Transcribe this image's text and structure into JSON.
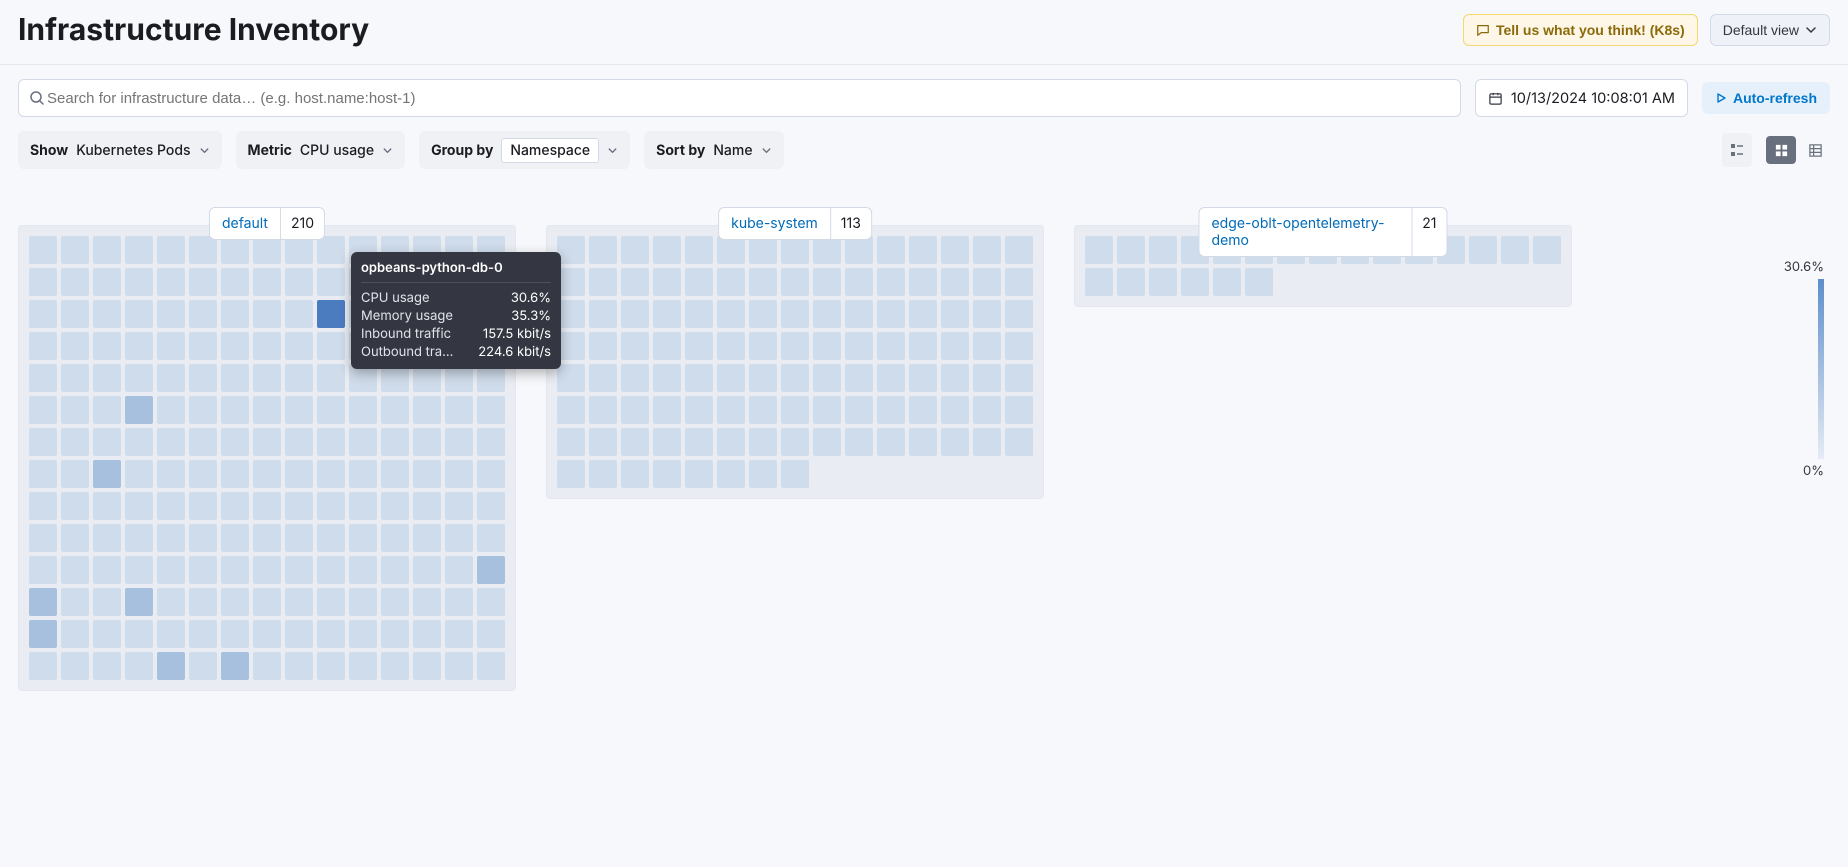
{
  "header": {
    "title": "Infrastructure Inventory",
    "feedback_label": "Tell us what you think! (K8s)",
    "view_label": "Default view"
  },
  "toolbar": {
    "search_placeholder": "Search for infrastructure data… (e.g. host.name:host-1)",
    "datetime": "10/13/2024 10:08:01 AM",
    "autorefresh_label": "Auto-refresh"
  },
  "filters": {
    "show_label": "Show",
    "show_value": "Kubernetes Pods",
    "metric_label": "Metric",
    "metric_value": "CPU usage",
    "groupby_label": "Group by",
    "groupby_value": "Namespace",
    "sortby_label": "Sort by",
    "sortby_value": "Name"
  },
  "legend": {
    "max": "30.6%",
    "min": "0%"
  },
  "tooltip": {
    "title": "opbeans-python-db-0",
    "rows": [
      {
        "k": "CPU usage",
        "v": "30.6%"
      },
      {
        "k": "Memory usage",
        "v": "35.3%"
      },
      {
        "k": "Inbound traffic",
        "v": "157.5 kbit/s"
      },
      {
        "k": "Outbound tra…",
        "v": "224.6 kbit/s"
      }
    ]
  },
  "groups": [
    {
      "name": "default",
      "count": "210",
      "cols": 15,
      "total": 210,
      "highlights": {
        "high": [
          39
        ],
        "mid": [
          78,
          107,
          164,
          165,
          168,
          180,
          199,
          201
        ]
      }
    },
    {
      "name": "kube-system",
      "count": "113",
      "cols": 15,
      "total": 113,
      "highlights": {
        "high": [],
        "mid": []
      }
    },
    {
      "name": "edge-oblt-opentelemetry-demo",
      "count": "21",
      "cols": 15,
      "total": 21,
      "highlights": {
        "high": [],
        "mid": []
      }
    }
  ]
}
